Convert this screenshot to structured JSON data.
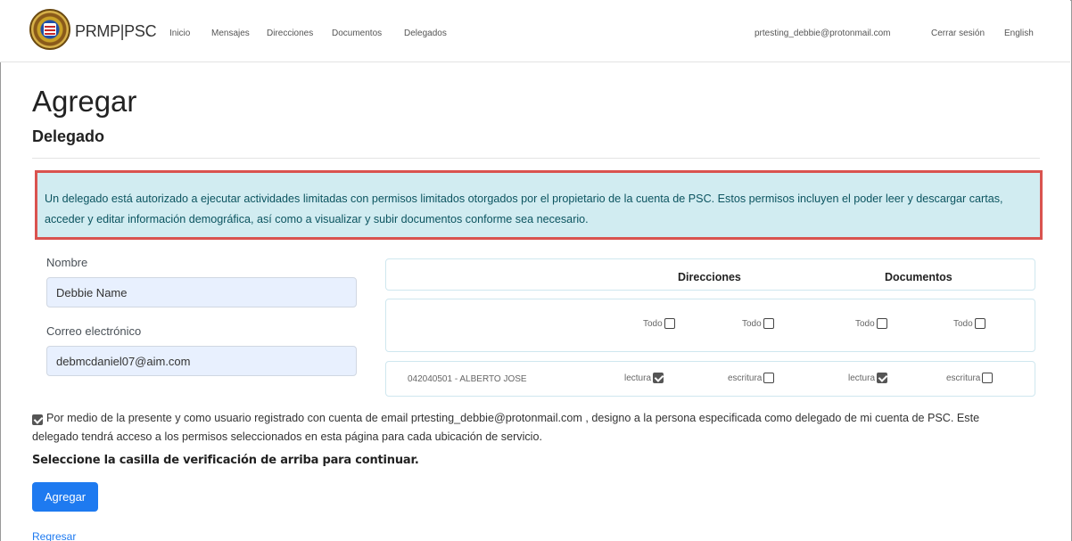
{
  "nav": {
    "brand": "PRMP|PSC",
    "links": [
      "Inicio",
      "Mensajes",
      "Direcciones",
      "Documentos",
      "Delegados"
    ],
    "user_email": "prtesting_debbie@protonmail.com",
    "logout": "Cerrar sesión",
    "language": "English"
  },
  "page": {
    "title": "Agregar",
    "subtitle": "Delegado"
  },
  "alert": {
    "text": "Un delegado está autorizado a ejecutar actividades limitadas con permisos limitados otorgados por el propietario de la cuenta de PSC. Estos permisos incluyen el poder leer y descargar cartas, acceder y editar información demográfica, así como a visualizar y subir documentos conforme sea necesario."
  },
  "form": {
    "name_label": "Nombre",
    "name_value": "Debbie Name",
    "email_label": "Correo electrónico",
    "email_value": "debmcdaniel07@aim.com"
  },
  "permissions": {
    "header_direcciones": "Direcciones",
    "header_documentos": "Documentos",
    "all_label": "Todo",
    "row": {
      "account": "042040501 - ALBERTO JOSE",
      "read_label": "lectura",
      "write_label": "escritura",
      "dir_read": true,
      "dir_write": false,
      "doc_read": true,
      "doc_write": false
    }
  },
  "consent": {
    "checked": true,
    "text": "Por medio de la presente y como usuario registrado con cuenta de email prtesting_debbie@protonmail.com , designo a la persona especificada como delegado de mi cuenta de PSC. Este delegado tendrá acceso a los permisos seleccionados en esta página para cada ubicación de servicio.",
    "warning": "Seleccione la casilla de verificación de arriba para continuar."
  },
  "actions": {
    "submit": "Agregar",
    "back": "Regresar"
  }
}
